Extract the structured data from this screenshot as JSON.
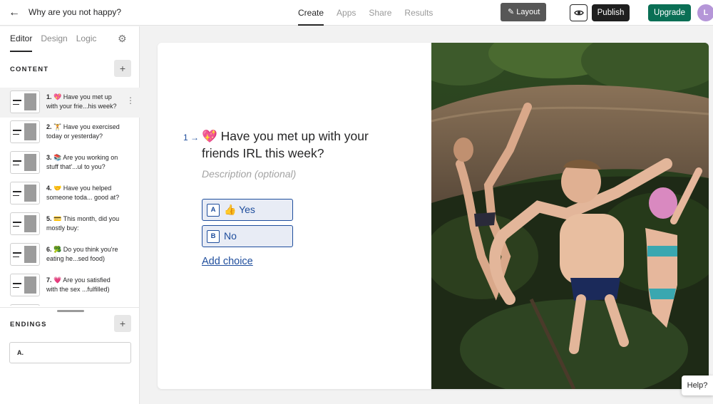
{
  "header": {
    "title": "Why are you not happy?",
    "tabs": [
      {
        "label": "Create"
      },
      {
        "label": "Apps"
      },
      {
        "label": "Share"
      },
      {
        "label": "Results"
      }
    ],
    "publish_label": "Publish",
    "upgrade_label": "Upgrade",
    "avatar_initial": "L"
  },
  "sidebar": {
    "tabs": [
      {
        "label": "Editor"
      },
      {
        "label": "Design"
      },
      {
        "label": "Logic"
      }
    ],
    "content_label": "CONTENT",
    "endings_label": "ENDINGS",
    "questions": [
      {
        "num": "1.",
        "emoji": "💖",
        "text": "Have you met up with your frie...his week?"
      },
      {
        "num": "2.",
        "emoji": "🏋",
        "text": "Have you exercised today or yesterday?"
      },
      {
        "num": "3.",
        "emoji": "📚",
        "text": "Are you working on stuff that'...ul to you?"
      },
      {
        "num": "4.",
        "emoji": "🤝",
        "text": "Have you helped someone toda... good at?"
      },
      {
        "num": "5.",
        "emoji": "💳",
        "text": "This month, did you mostly buy:"
      },
      {
        "num": "6.",
        "emoji": "🥦",
        "text": "Do you think you're eating he...sed food)"
      },
      {
        "num": "7.",
        "emoji": "💗",
        "text": "Are you satisfied with the sex ...fulfilled)"
      }
    ],
    "ending": {
      "label": "A."
    }
  },
  "canvas": {
    "question_number": "1",
    "question_arrow": "→",
    "question_emoji": "💖",
    "question_text": "Have you met up with your friends IRL this week?",
    "description_placeholder": "Description (optional)",
    "choices": [
      {
        "key": "A",
        "label": "👍 Yes"
      },
      {
        "key": "B",
        "label": "No"
      }
    ],
    "add_choice_label": "Add choice",
    "layout_label": "Layout"
  },
  "help_label": "Help?",
  "colors": {
    "accent": "#1e4d9c",
    "publish": "#1f1f1f",
    "upgrade": "#0a6f55"
  }
}
